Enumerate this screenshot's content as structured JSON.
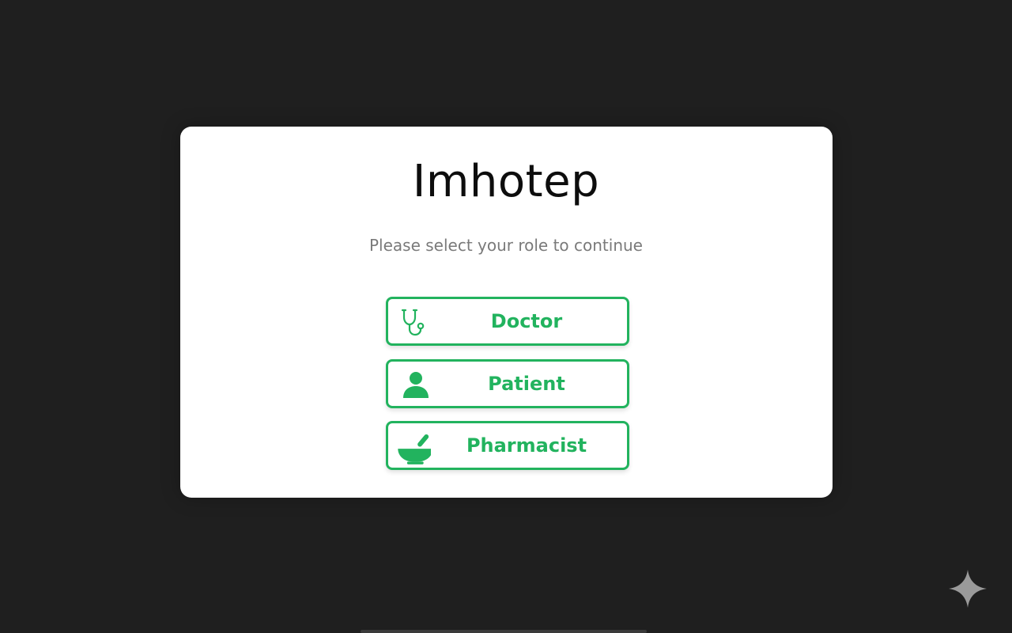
{
  "app": {
    "title": "Imhotep",
    "subtitle": "Please select your role to continue"
  },
  "roles": [
    {
      "label": "Doctor",
      "icon": "stethoscope-icon"
    },
    {
      "label": "Patient",
      "icon": "person-icon"
    },
    {
      "label": "Pharmacist",
      "icon": "mortar-pestle-icon"
    }
  ],
  "colors": {
    "background": "#1f1f1f",
    "card": "#ffffff",
    "accent": "#22b35e",
    "title": "#0d0d0d",
    "subtitle": "#7a7a7a"
  },
  "watermark": {
    "icon": "sparkle-icon"
  }
}
